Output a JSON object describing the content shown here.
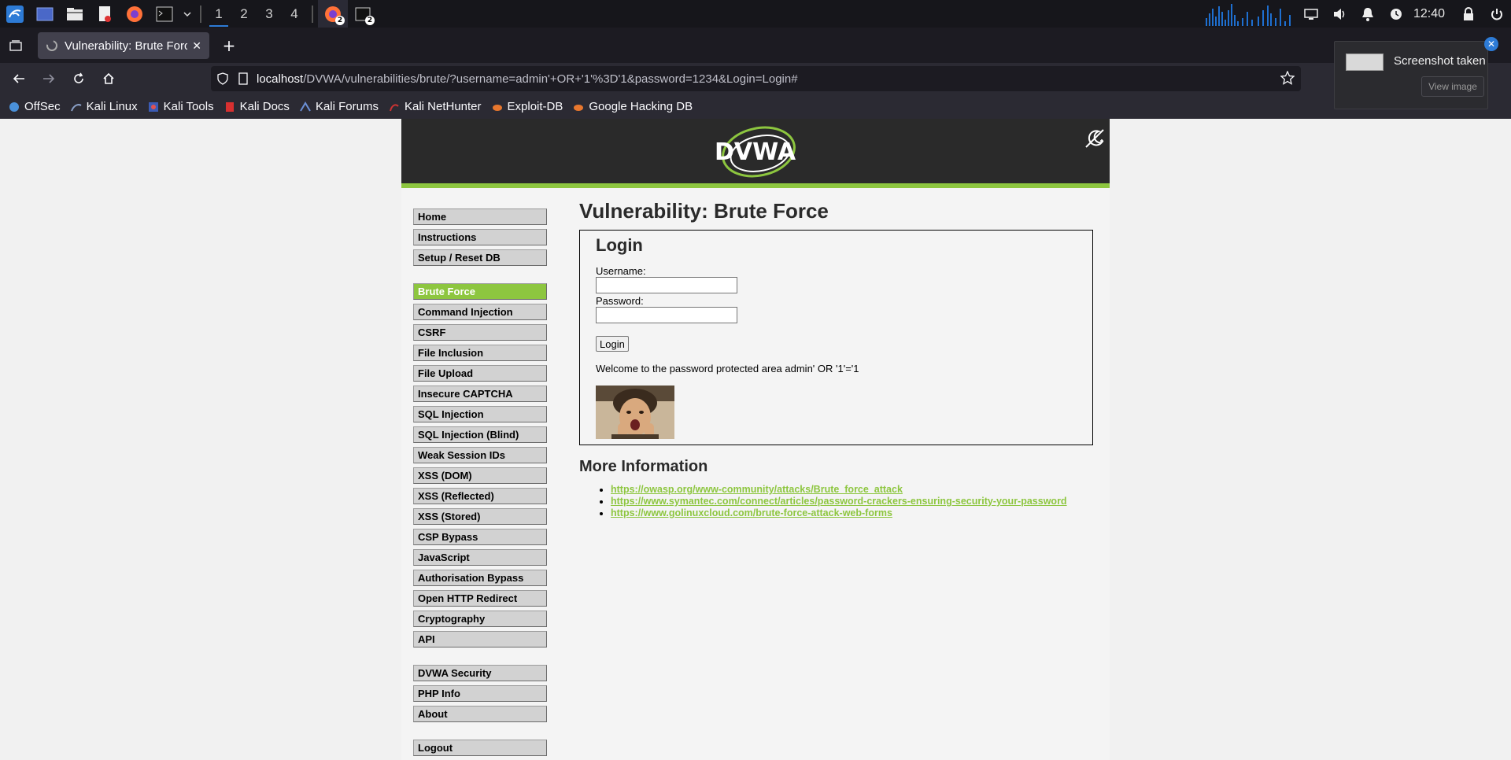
{
  "taskbar": {
    "workspaces": [
      "1",
      "2",
      "3",
      "4"
    ],
    "active_workspace": "1",
    "firefox_badge": "2",
    "terminal_badge": "2",
    "clock": "12:40"
  },
  "browser": {
    "tab_title": "Vulnerability: Brute Force",
    "url_host": "localhost",
    "url_path": "/DVWA/vulnerabilities/brute/?username=admin'+OR+'1'%3D'1&password=1234&Login=Login#",
    "bookmarks": [
      {
        "label": "OffSec",
        "icon": "offsec-icon",
        "color": "#4a90d9"
      },
      {
        "label": "Kali Linux",
        "icon": "kali-dragon-icon",
        "color": "#8aa0c8"
      },
      {
        "label": "Kali Tools",
        "icon": "kali-tools-icon",
        "color": "#e05252"
      },
      {
        "label": "Kali Docs",
        "icon": "kali-docs-icon",
        "color": "#d83030"
      },
      {
        "label": "Kali Forums",
        "icon": "kali-forums-icon",
        "color": "#6b8fd6"
      },
      {
        "label": "Kali NetHunter",
        "icon": "nethunter-icon",
        "color": "#cc3333"
      },
      {
        "label": "Exploit-DB",
        "icon": "exploitdb-icon",
        "color": "#e8772e"
      },
      {
        "label": "Google Hacking DB",
        "icon": "ghdb-icon",
        "color": "#e8772e"
      }
    ]
  },
  "dvwa": {
    "logo_text": "DVWA",
    "menu_group1": [
      "Home",
      "Instructions",
      "Setup / Reset DB"
    ],
    "menu_group2": [
      "Brute Force",
      "Command Injection",
      "CSRF",
      "File Inclusion",
      "File Upload",
      "Insecure CAPTCHA",
      "SQL Injection",
      "SQL Injection (Blind)",
      "Weak Session IDs",
      "XSS (DOM)",
      "XSS (Reflected)",
      "XSS (Stored)",
      "CSP Bypass",
      "JavaScript",
      "Authorisation Bypass",
      "Open HTTP Redirect",
      "Cryptography",
      "API"
    ],
    "menu_group3": [
      "DVWA Security",
      "PHP Info",
      "About"
    ],
    "menu_group4": [
      "Logout"
    ],
    "selected_item": "Brute Force",
    "page_title": "Vulnerability: Brute Force",
    "login_heading": "Login",
    "username_label": "Username:",
    "password_label": "Password:",
    "username_value": "",
    "password_value": "",
    "login_button": "Login",
    "welcome_text": "Welcome to the password protected area admin' OR '1'='1",
    "more_info_heading": "More Information",
    "links": [
      "https://owasp.org/www-community/attacks/Brute_force_attack",
      "https://www.symantec.com/connect/articles/password-crackers-ensuring-security-your-password",
      "https://www.golinuxcloud.com/brute-force-attack-web-forms"
    ],
    "accent_color": "#8dc63f"
  },
  "notification": {
    "title": "Screenshot taken",
    "button": "View image"
  }
}
